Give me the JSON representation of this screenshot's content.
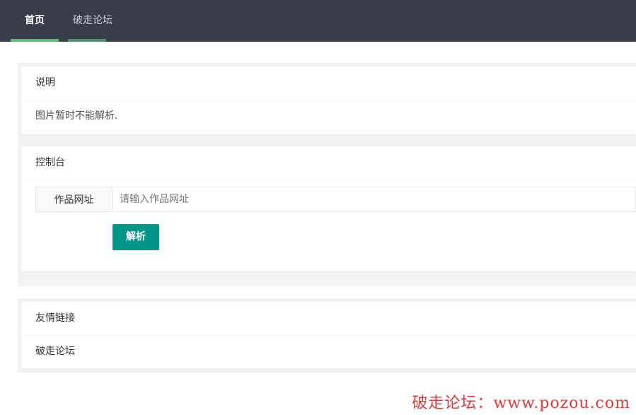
{
  "nav": {
    "home_label": "首页",
    "forum_label": "破走论坛",
    "active_color": "#5fb878",
    "bg_color": "#393d49"
  },
  "description": {
    "title": "说明",
    "text": "图片暂时不能解析."
  },
  "console": {
    "title": "控制台",
    "field_label": "作品网址",
    "input_value": "",
    "input_placeholder": "请输入作品网址",
    "submit_label": "解析",
    "button_color": "#009688"
  },
  "friend_links": {
    "title": "友情链接",
    "items": [
      "破走论坛"
    ]
  },
  "watermark": "破走论坛：www.pozou.com"
}
